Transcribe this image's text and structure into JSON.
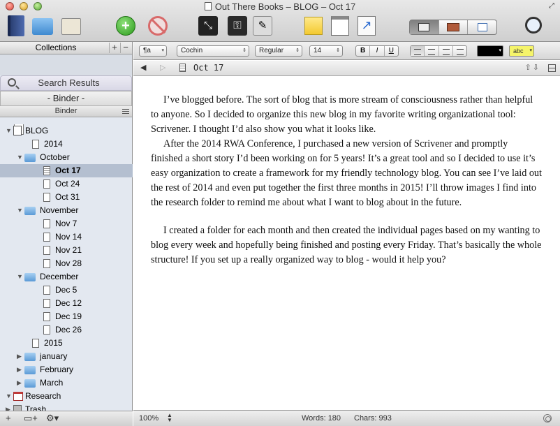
{
  "window": {
    "title": "Out There Books – BLOG – Oct 17",
    "fullscreen_glyph": "⤢"
  },
  "toolbar": {
    "add_glyph": "+",
    "compose_glyph": "⤡",
    "keywords_glyph": "⚿",
    "inspector_glyph": "✎",
    "share_glyph": "↗"
  },
  "collections": {
    "header": "Collections",
    "add": "+",
    "remove": "−",
    "search_results": "Search Results",
    "binder_tab": "- Binder -"
  },
  "binder": {
    "header": "Binder",
    "items": [
      {
        "label": "BLOG",
        "type": "stack",
        "level": 0,
        "expanded": true
      },
      {
        "label": "2014",
        "type": "doc",
        "level": 1
      },
      {
        "label": "October",
        "type": "folder",
        "level": 1,
        "expanded": true
      },
      {
        "label": "Oct 17",
        "type": "doc-text",
        "level": 2,
        "selected": true
      },
      {
        "label": "Oct 24",
        "type": "doc",
        "level": 2
      },
      {
        "label": "Oct 31",
        "type": "doc",
        "level": 2
      },
      {
        "label": "November",
        "type": "folder",
        "level": 1,
        "expanded": true
      },
      {
        "label": "Nov 7",
        "type": "doc",
        "level": 2
      },
      {
        "label": "Nov 14",
        "type": "doc",
        "level": 2
      },
      {
        "label": "Nov 21",
        "type": "doc",
        "level": 2
      },
      {
        "label": "Nov 28",
        "type": "doc",
        "level": 2
      },
      {
        "label": "December",
        "type": "folder",
        "level": 1,
        "expanded": true
      },
      {
        "label": "Dec 5",
        "type": "doc",
        "level": 2
      },
      {
        "label": "Dec 12",
        "type": "doc",
        "level": 2
      },
      {
        "label": "Dec 19",
        "type": "doc",
        "level": 2
      },
      {
        "label": "Dec 26",
        "type": "doc",
        "level": 2
      },
      {
        "label": "2015",
        "type": "doc",
        "level": 1
      },
      {
        "label": "january",
        "type": "folder",
        "level": 1,
        "expanded": false
      },
      {
        "label": "February",
        "type": "folder",
        "level": 1,
        "expanded": false
      },
      {
        "label": "March",
        "type": "folder",
        "level": 1,
        "expanded": false
      },
      {
        "label": "Research",
        "type": "research",
        "level": 0,
        "expanded": true
      },
      {
        "label": "Trash",
        "type": "trash",
        "level": 0,
        "expanded": false
      }
    ],
    "footer": {
      "add": "+",
      "add_folder": "▭+",
      "gear": "⚙▾"
    }
  },
  "formatbar": {
    "style": "¶a",
    "font": "Cochin",
    "face": "Regular",
    "size": "14",
    "bold": "B",
    "italic": "I",
    "underline": "U",
    "text_color": "#000000",
    "highlight": "abc",
    "highlight_color": "#f5f46a"
  },
  "header": {
    "back": "◀",
    "forward": "▷",
    "doc_title": "Oct 17",
    "up_down": "⇧⇩"
  },
  "document": {
    "paragraphs": [
      "I’ve blogged before.  The sort of blog that is more stream of consciousness rather than helpful to anyone.  So I decided to organize this new blog in my favorite writing organizational tool: Scrivener.  I thought I’d also show you what it looks like.",
      "After the 2014 RWA Conference, I purchased a new version of Scrivener and promptly finished a short story I’d been working on for 5 years!  It’s a great tool and so I decided to use it’s easy organization to create a framework for my friendly technology blog.  You can see I’ve laid out the rest of 2014 and even put together the first three months in 2015!  I’ll throw images I find into the research folder to remind me about what I want to blog about in the future.",
      "I created a folder for each month and then created the individual pages based on my wanting to blog every week and hopefully being finished and posting every Friday.  That’s basically the whole structure!  If you set up a really organized way to blog - would it help you?"
    ]
  },
  "footer": {
    "zoom": "100%",
    "words": "Words: 180",
    "chars": "Chars: 993"
  }
}
